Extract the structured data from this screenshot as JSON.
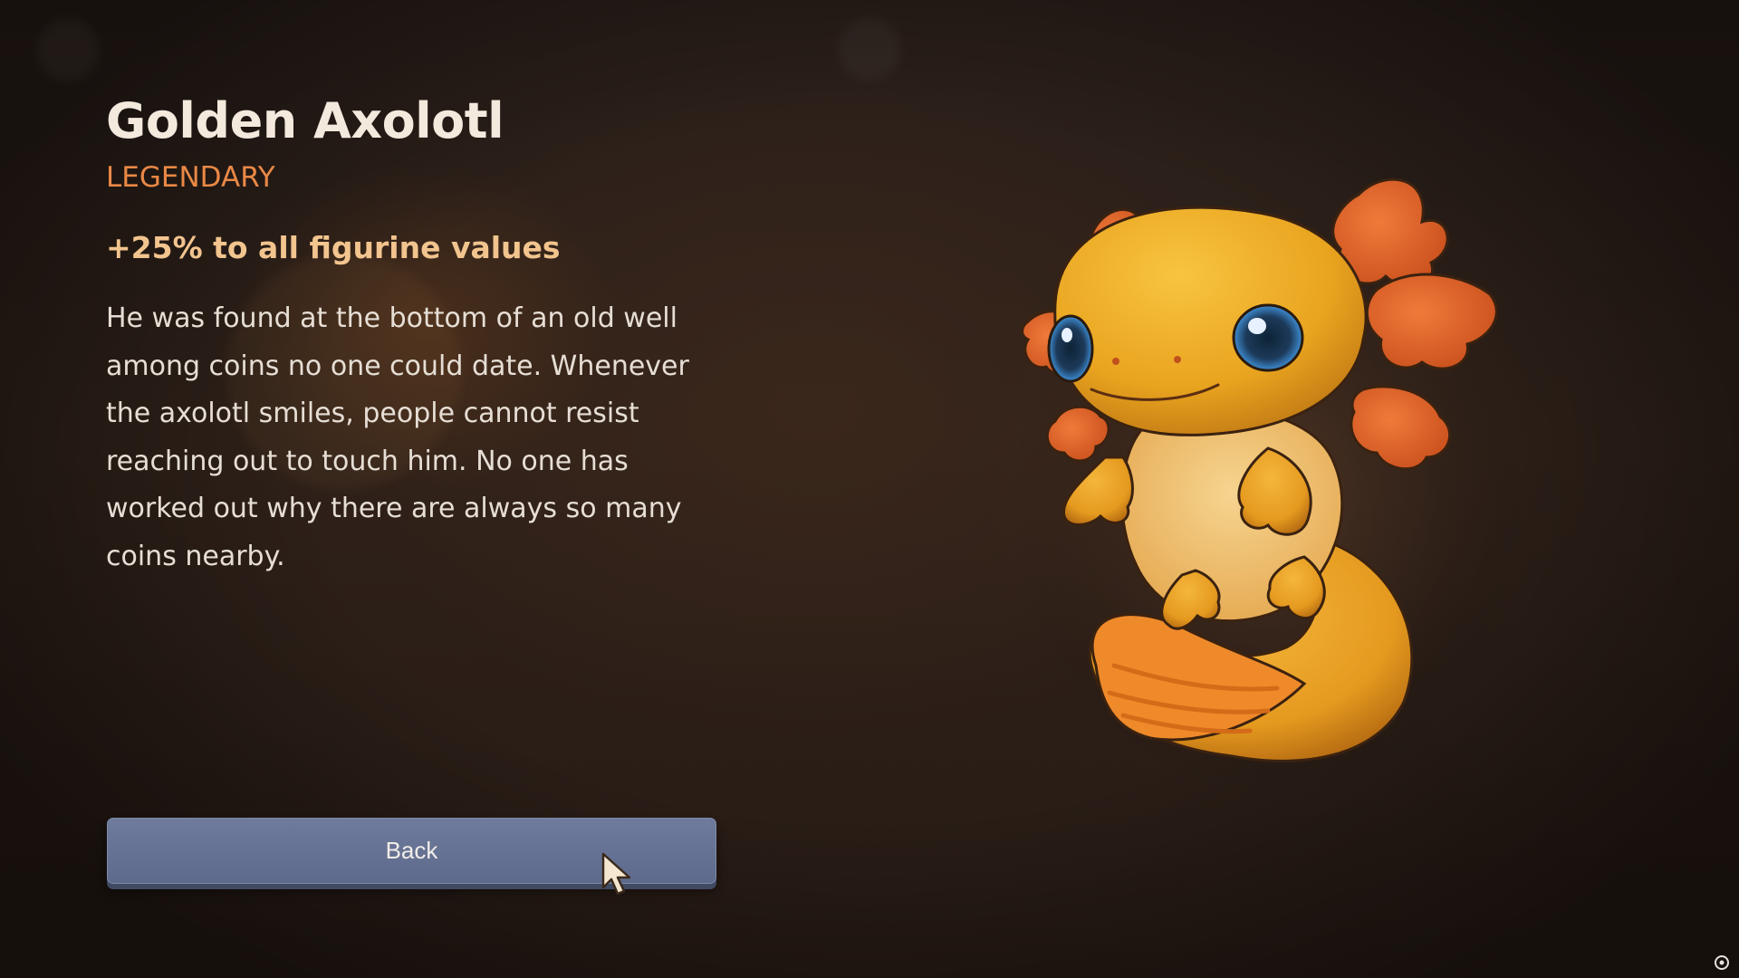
{
  "item": {
    "name": "Golden Axolotl",
    "rarity": "LEGENDARY",
    "effect": "+25% to all figurine values",
    "description": "He was found at the bottom of an old well among coins no one could date. Whenever the axolotl smiles, people cannot resist reaching out to touch him. No one has worked out why there are always so many coins nearby."
  },
  "actions": {
    "back_label": "Back"
  },
  "icons": {
    "figure": "golden-axolotl-figurine",
    "cursor": "mouse-pointer-icon",
    "corner": "settings-small-icon"
  },
  "colors": {
    "rarity": "#e98846",
    "effect": "#f2c48e",
    "button": "#66729a"
  }
}
